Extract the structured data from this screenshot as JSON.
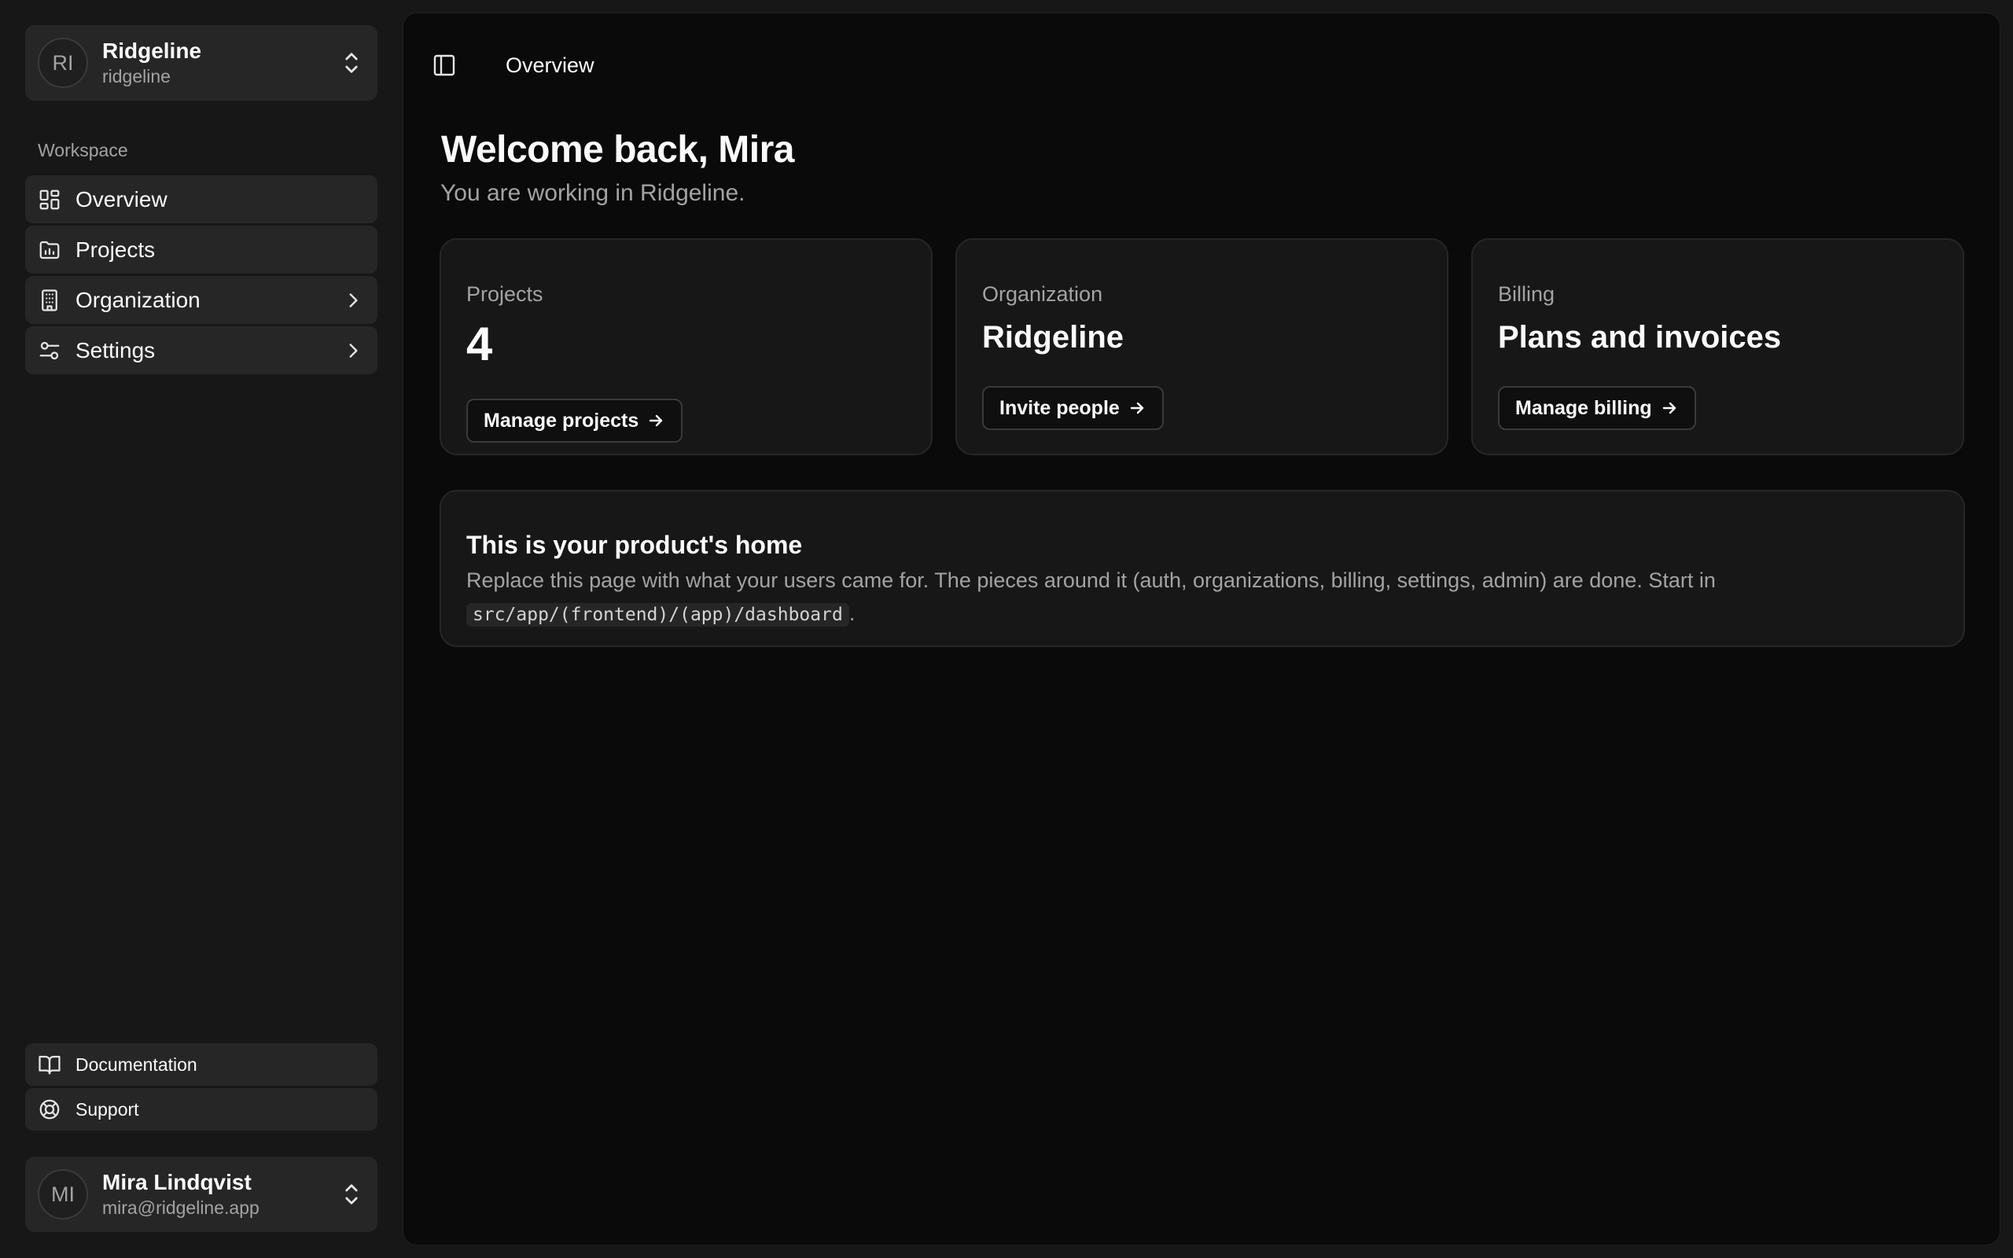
{
  "sidebar": {
    "org": {
      "initials": "RI",
      "name": "Ridgeline",
      "slug": "ridgeline"
    },
    "group_label": "Workspace",
    "nav": [
      {
        "label": "Overview",
        "icon": "layout-dashboard-icon"
      },
      {
        "label": "Projects",
        "icon": "folder-chart-icon"
      },
      {
        "label": "Organization",
        "icon": "building-icon",
        "has_children": true
      },
      {
        "label": "Settings",
        "icon": "sliders-icon",
        "has_children": true
      }
    ],
    "footer_links": [
      {
        "label": "Documentation",
        "icon": "book-open-icon"
      },
      {
        "label": "Support",
        "icon": "life-buoy-icon"
      }
    ],
    "user": {
      "initials": "MI",
      "name": "Mira Lindqvist",
      "email": "mira@ridgeline.app"
    }
  },
  "header": {
    "breadcrumb": "Overview"
  },
  "main": {
    "title": "Welcome back, Mira",
    "subtitle": "You are working in Ridgeline.",
    "cards": [
      {
        "label": "Projects",
        "value": "4",
        "button": "Manage projects"
      },
      {
        "label": "Organization",
        "value": "Ridgeline",
        "button": "Invite people"
      },
      {
        "label": "Billing",
        "value": "Plans and invoices",
        "button": "Manage billing"
      }
    ],
    "home": {
      "title": "This is your product's home",
      "description": "Replace this page with what your users came for. The pieces around it (auth, organizations, billing, settings, admin) are done. Start in",
      "path": "src/app/(frontend)/(app)/dashboard",
      "suffix": "."
    }
  },
  "colors": {
    "background": "#171717",
    "main_panel": "#0a0a0a",
    "card": "#171717",
    "muted_text": "#a3a3a3"
  }
}
